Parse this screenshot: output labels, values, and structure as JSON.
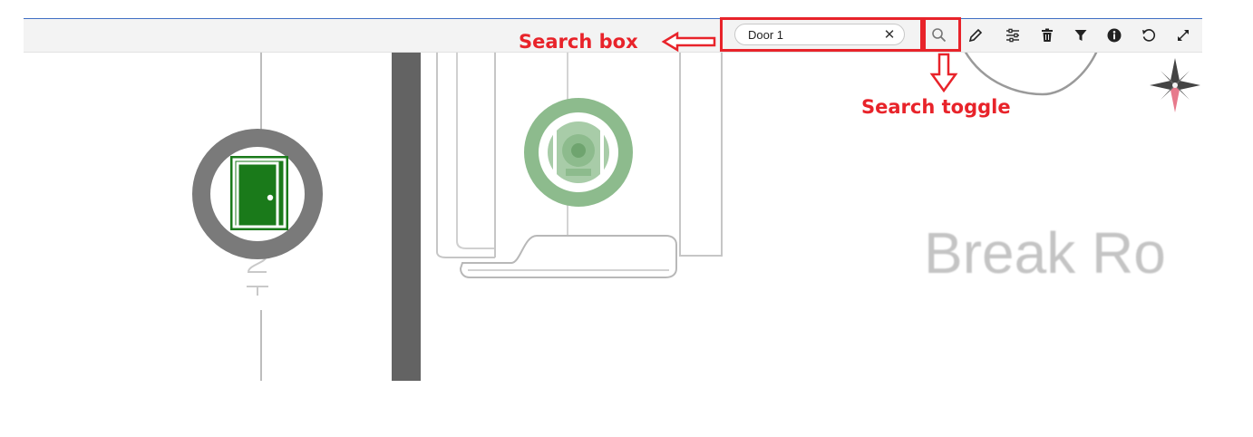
{
  "toolbar": {
    "search_input_value": "Door 1",
    "search_input_placeholder": "",
    "clear_symbol": "✕"
  },
  "map": {
    "room_label": "Break Ro",
    "door_marker_icon": "door-icon",
    "camera_marker_icon": "camera-icon",
    "compass_icon": "compass-rose-icon"
  },
  "annotations": {
    "search_box_label": "Search box",
    "search_toggle_label": "Search toggle",
    "color": "#e8232a"
  },
  "colors": {
    "door_marker_ring": "#7a7a7a",
    "door_marker_fill": "#1a7a1a",
    "camera_marker": "#8dbb8d",
    "toolbar_bg": "#f3f3f3",
    "top_border": "#3f6fc4"
  }
}
